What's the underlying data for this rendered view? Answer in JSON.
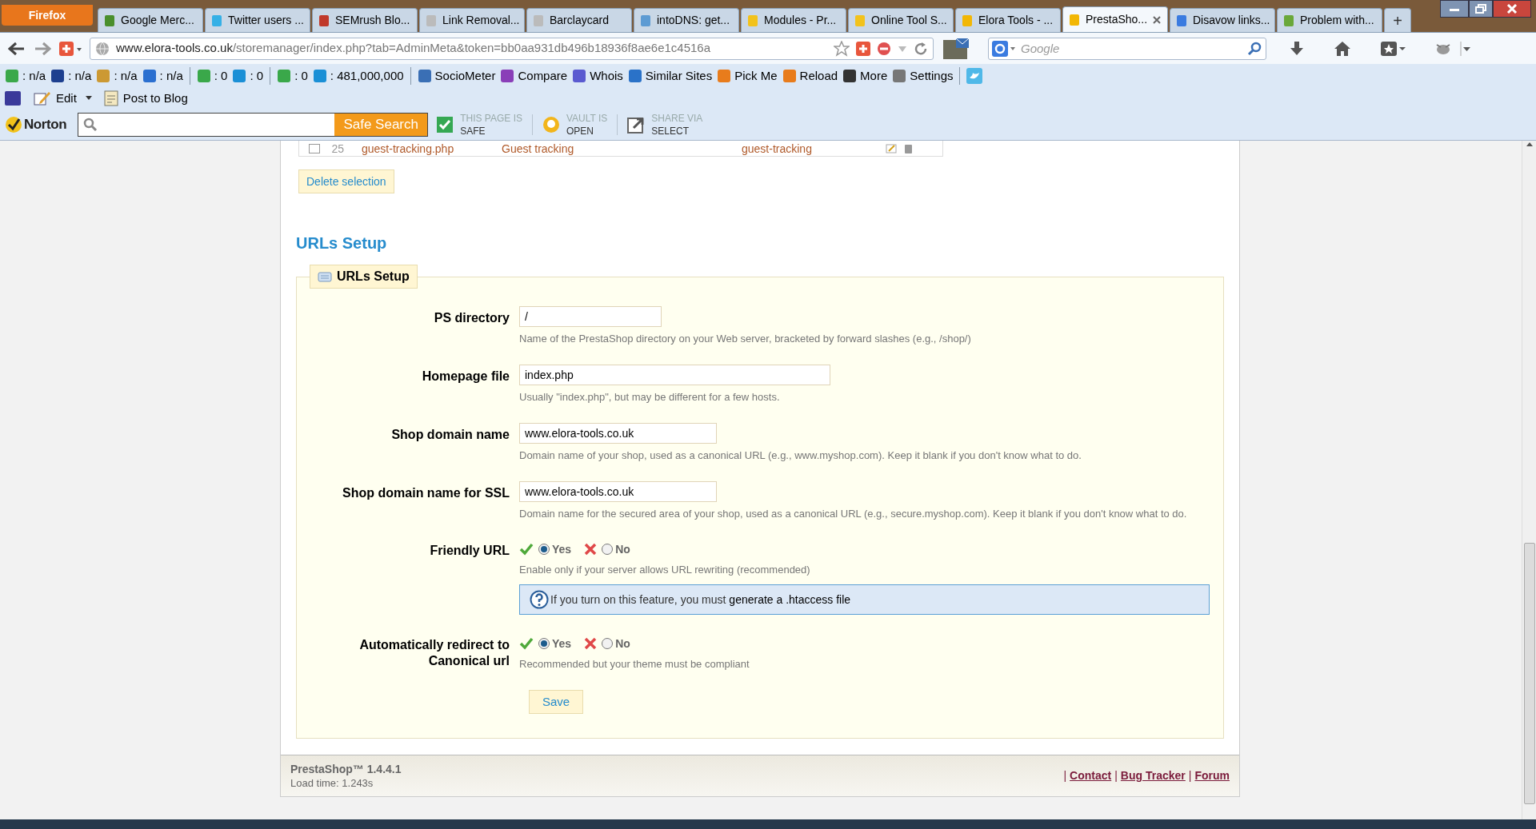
{
  "browser": {
    "menu_button": "Firefox",
    "tabs": [
      {
        "label": "Google Merc...",
        "selected": false
      },
      {
        "label": "Twitter users ...",
        "selected": false
      },
      {
        "label": "SEMrush Blo...",
        "selected": false
      },
      {
        "label": "Link Removal...",
        "selected": false
      },
      {
        "label": "Barclaycard",
        "selected": false
      },
      {
        "label": "intoDNS: get...",
        "selected": false
      },
      {
        "label": "Modules - Pr...",
        "selected": false
      },
      {
        "label": "Online Tool S...",
        "selected": false
      },
      {
        "label": "Elora Tools - ...",
        "selected": false
      },
      {
        "label": "PrestaSho...",
        "selected": true
      },
      {
        "label": "Disavow links...",
        "selected": false
      },
      {
        "label": "Problem with...",
        "selected": false
      }
    ],
    "new_tab": "+",
    "url": {
      "domain": "www.elora-tools.co.uk",
      "path": "/storemanager/index.php?tab=AdminMeta&token=bb0aa931db496b18936f8ae6e1c4516a"
    },
    "search": {
      "placeholder": "Google"
    },
    "toolbar": [
      [
        ": n/a",
        ": n/a",
        ": n/a",
        ": n/a"
      ],
      [
        ": 0",
        ": 0"
      ],
      [
        ": 0",
        ": 481,000,000"
      ],
      [
        "SocioMeter",
        "Compare",
        "Whois",
        "Similar Sites",
        "Pick Me",
        "Reload",
        "More",
        "Settings"
      ]
    ],
    "edit_bar": [
      "Edit",
      "Post to Blog"
    ],
    "norton": {
      "logo": "Norton",
      "search_button": "Safe Search",
      "statuses": [
        {
          "caption": "THIS PAGE IS",
          "value": "SAFE"
        },
        {
          "caption": "VAULT IS",
          "value": "OPEN"
        },
        {
          "caption": "SHARE VIA",
          "value": "SELECT"
        }
      ]
    }
  },
  "page": {
    "partial_row": {
      "checked": false,
      "cells": [
        "25",
        "guest-tracking.php",
        "Guest tracking",
        "guest-tracking"
      ]
    },
    "delete_button": "Delete selection",
    "heading": "URLs Setup",
    "fieldset": {
      "legend": "URLs Setup",
      "rows": [
        {
          "kind": "text",
          "label": "PS directory",
          "value": "/",
          "help": "Name of the PrestaShop directory on your Web server, bracketed by forward slashes (e.g., /shop/)"
        },
        {
          "kind": "text",
          "label": "Homepage file",
          "value": "index.php",
          "help": "Usually \"index.php\", but may be different for a few hosts."
        },
        {
          "kind": "text",
          "label": "Shop domain name",
          "value": "www.elora-tools.co.uk",
          "help": "Domain name of your shop, used as a canonical URL (e.g., www.myshop.com). Keep it blank if you don't know what to do."
        },
        {
          "kind": "text",
          "label": "Shop domain name for SSL",
          "value": "www.elora-tools.co.uk",
          "help": "Domain name for the secured area of your shop, used as a canonical URL (e.g., secure.myshop.com). Keep it blank if you don't know what to do."
        },
        {
          "kind": "radio",
          "label": "Friendly URL",
          "options": [
            {
              "label": "Yes",
              "selected": true
            },
            {
              "label": "No",
              "selected": false
            }
          ],
          "help": "Enable only if your server allows URL rewriting (recommended)",
          "note": "If you turn on this feature, you must ",
          "note_link": "generate a .htaccess file"
        },
        {
          "kind": "radio",
          "label": "Automatically redirect to Canonical url",
          "options": [
            {
              "label": "Yes",
              "selected": true
            },
            {
              "label": "No",
              "selected": false
            }
          ],
          "help": "Recommended but your theme must be compliant"
        }
      ],
      "save_button": "Save"
    },
    "footer": {
      "version": "PrestaShop™ 1.4.4.1",
      "load_time": "Load time: 1.243s",
      "links": [
        {
          "separator": "|",
          "label": "Contact"
        },
        {
          "separator": "|",
          "label": "Bug Tracker"
        },
        {
          "separator": "|",
          "label": "Forum"
        }
      ]
    }
  }
}
